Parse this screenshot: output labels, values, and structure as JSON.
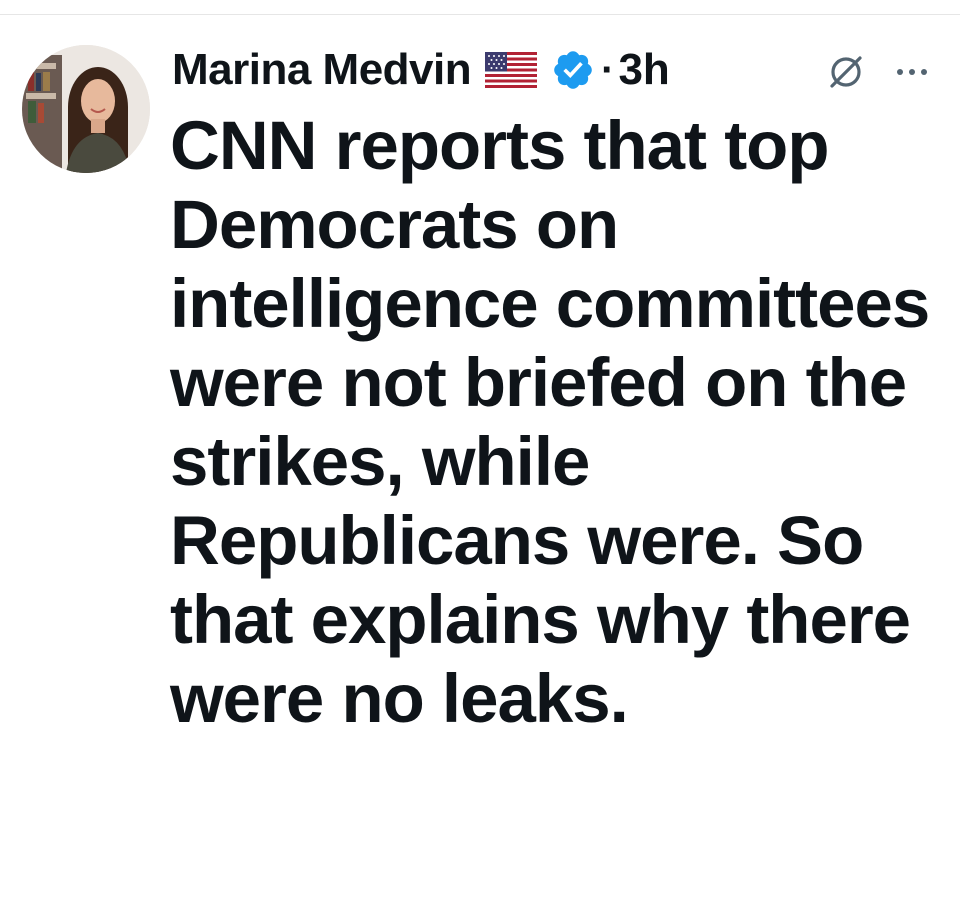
{
  "tweet": {
    "author": {
      "display_name": "Marina Medvin",
      "flag_emoji": "us-flag-icon",
      "verified_badge": "verified-badge-icon",
      "verified_color": "#1d9bf0"
    },
    "separator": "·",
    "timestamp": "3h",
    "actions": {
      "grok_icon": "grok-icon",
      "more_icon": "more-options-icon"
    },
    "text": "CNN reports that top Democrats on intelligence committees were not briefed on the strikes, while Republicans were. So that explains why there were no leaks."
  },
  "colors": {
    "text": "#0f1419",
    "secondary": "#536471",
    "background": "#ffffff"
  }
}
